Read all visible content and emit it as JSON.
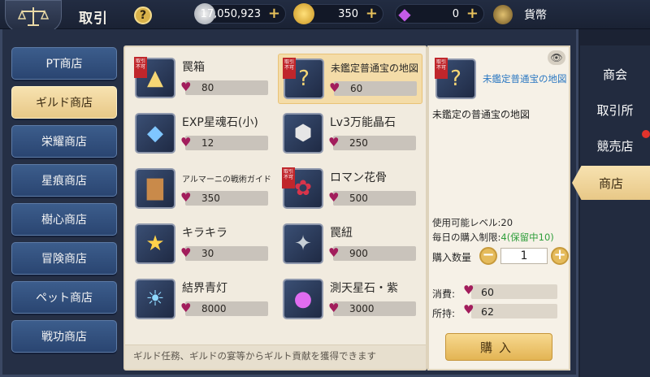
{
  "header": {
    "title": "取引",
    "help_label": "?",
    "silver": "17,050,923",
    "gold": "350",
    "crystal": "0",
    "currency_label": "貨幣"
  },
  "left_nav": [
    {
      "label": "PT商店",
      "active": false
    },
    {
      "label": "ギルド商店",
      "active": true
    },
    {
      "label": "栄耀商店",
      "active": false
    },
    {
      "label": "星痕商店",
      "active": false
    },
    {
      "label": "樹心商店",
      "active": false
    },
    {
      "label": "冒険商店",
      "active": false
    },
    {
      "label": "ペット商店",
      "active": false
    },
    {
      "label": "戦功商店",
      "active": false
    }
  ],
  "items": [
    {
      "name": "罠箱",
      "price": "80",
      "ribbon": "取引不可",
      "icon": "trap-box-icon"
    },
    {
      "name": "未鑑定普通宝の地図",
      "price": "60",
      "ribbon": "取引不可",
      "icon": "treasure-map-icon",
      "selected": true
    },
    {
      "name": "EXP星魂石(小)",
      "price": "12",
      "icon": "blue-crystal-icon"
    },
    {
      "name": "Lv3万能晶石",
      "price": "250",
      "icon": "white-crystal-icon"
    },
    {
      "name": "アルマーニの戦術ガイド",
      "price": "350",
      "icon": "book-icon",
      "small": true
    },
    {
      "name": "ロマン花骨",
      "price": "500",
      "ribbon": "取引不可",
      "icon": "rose-icon"
    },
    {
      "name": "キラキラ",
      "price": "30",
      "icon": "star-icon"
    },
    {
      "name": "罠紐",
      "price": "900",
      "icon": "rope-icon"
    },
    {
      "name": "結界青灯",
      "price": "8000",
      "icon": "lantern-icon"
    },
    {
      "name": "測天星石・紫",
      "price": "3000",
      "icon": "purple-orb-icon"
    }
  ],
  "footer_note": "ギルド任務、ギルドの宴等からギルト貢献を獲得できます",
  "detail": {
    "name": "未鑑定普通宝の地図",
    "ribbon": "取引不可",
    "description": "未鑑定の普通宝の地図",
    "usable_level": "使用可能レベル:20",
    "daily_limit_prefix": "毎日の購入制限:",
    "daily_limit_value": "4(保留中10)",
    "quantity_label": "購入数量",
    "quantity": "1",
    "cost_label": "消費:",
    "cost": "60",
    "owned_label": "所持:",
    "owned": "62",
    "buy_label": "購入"
  },
  "right_tabs": [
    {
      "label": "商会",
      "active": false
    },
    {
      "label": "取引所",
      "active": false
    },
    {
      "label": "競売店",
      "active": false
    },
    {
      "label": "商店",
      "active": true
    }
  ],
  "colors": {
    "accent_gold": "#e8c887",
    "nav_blue": "#2a4571",
    "price_gem": "#a21d5c",
    "limit_green": "#2f9e3b",
    "detail_name_blue": "#2b78c2"
  }
}
